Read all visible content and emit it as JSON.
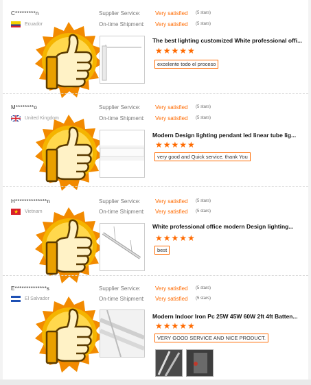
{
  "colors": {
    "accent": "#ff6a00",
    "thumb_gold": "#f5b400",
    "thumb_orange": "#f28a00"
  },
  "icons": {
    "thumbs_up": "thumbs-up-badge-icon",
    "star": "star-icon"
  },
  "labels": {
    "supplier_service": "Supplier Service:",
    "ontime_shipment": "On-time Shipment:",
    "very_satisfied": "Very satisfied",
    "five_stars": "(5 stars)"
  },
  "reviews": [
    {
      "buyer": "C*********n",
      "country": "Ecuador",
      "product_title": "The best lighting customized White professional offi...",
      "rating": "★★★★★",
      "comment": "excelente todo el proceso"
    },
    {
      "buyer": "M********o",
      "country": "United Kingdom",
      "product_title": "Modern Design lighting pendant led linear tube lig...",
      "rating": "★★★★★",
      "comment": "very good and Quick service.  thank You"
    },
    {
      "buyer": "H**************n",
      "country": "Vietnam",
      "product_title": "White professional office modern Design lighting...",
      "rating": "★★★★★",
      "comment": "best"
    },
    {
      "buyer": "E**************s",
      "country": "El Salvador",
      "product_title": "Modern Indoor Iron Pc 25W 45W 60W 2ft 4ft Batten...",
      "rating": "★★★★★",
      "comment": "VERY GOOD SERVICE AND NICE PRODUCT."
    }
  ]
}
